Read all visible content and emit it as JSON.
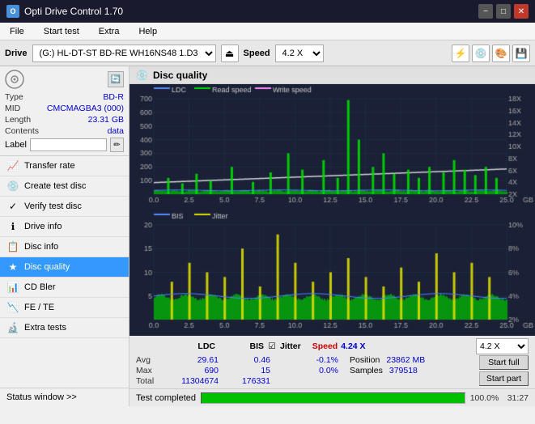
{
  "titleBar": {
    "title": "Opti Drive Control 1.70",
    "iconText": "O",
    "minBtn": "−",
    "maxBtn": "□",
    "closeBtn": "✕"
  },
  "menuBar": {
    "items": [
      "File",
      "Start test",
      "Extra",
      "Help"
    ]
  },
  "driveBar": {
    "label": "Drive",
    "driveValue": "(G:)  HL-DT-ST BD-RE  WH16NS48 1.D3",
    "ejectIcon": "⏏",
    "speedLabel": "Speed",
    "speedValue": "4.2 X",
    "actionBtns": [
      "⚡",
      "💿",
      "🔧",
      "💾"
    ]
  },
  "disc": {
    "typeLabel": "Type",
    "typeValue": "BD-R",
    "midLabel": "MID",
    "midValue": "CMCMAGBA3 (000)",
    "lengthLabel": "Length",
    "lengthValue": "23.31 GB",
    "contentsLabel": "Contents",
    "contentsValue": "data",
    "labelLabel": "Label"
  },
  "sidebar": {
    "navItems": [
      {
        "id": "transfer-rate",
        "label": "Transfer rate",
        "icon": "📈"
      },
      {
        "id": "create-test-disc",
        "label": "Create test disc",
        "icon": "💿"
      },
      {
        "id": "verify-test-disc",
        "label": "Verify test disc",
        "icon": "✓"
      },
      {
        "id": "drive-info",
        "label": "Drive info",
        "icon": "ℹ"
      },
      {
        "id": "disc-info",
        "label": "Disc info",
        "icon": "📋"
      },
      {
        "id": "disc-quality",
        "label": "Disc quality",
        "icon": "★",
        "active": true
      },
      {
        "id": "cd-bler",
        "label": "CD Bler",
        "icon": "📊"
      },
      {
        "id": "fe-te",
        "label": "FE / TE",
        "icon": "📉"
      },
      {
        "id": "extra-tests",
        "label": "Extra tests",
        "icon": "🔬"
      }
    ],
    "statusWindow": "Status window >>"
  },
  "discQuality": {
    "title": "Disc quality",
    "legends1": {
      "ldc": "LDC",
      "readSpeed": "Read speed",
      "writeSpeed": "Write speed"
    },
    "legends2": {
      "bis": "BIS",
      "jitter": "Jitter"
    },
    "yAxis1": [
      700,
      600,
      500,
      400,
      300,
      200,
      100
    ],
    "yAxis1Right": [
      "18X",
      "16X",
      "14X",
      "12X",
      "10X",
      "8X",
      "6X",
      "4X",
      "2X"
    ],
    "xAxis": [
      "0.0",
      "2.5",
      "5.0",
      "7.5",
      "10.0",
      "12.5",
      "15.0",
      "17.5",
      "20.0",
      "22.5",
      "25.0"
    ],
    "yAxis2": [
      20,
      15,
      10,
      5
    ],
    "yAxis2Right": [
      "10%",
      "8%",
      "6%",
      "4%",
      "2%"
    ]
  },
  "stats": {
    "headers": {
      "ldc": "LDC",
      "bis": "BIS",
      "jitter": "Jitter",
      "speed": "Speed",
      "speedVal": "4.24 X"
    },
    "avg": {
      "label": "Avg",
      "ldc": "29.61",
      "bis": "0.46",
      "jitter": "-0.1%"
    },
    "max": {
      "label": "Max",
      "ldc": "690",
      "bis": "15",
      "jitter": "0.0%",
      "position": "23862 MB"
    },
    "total": {
      "label": "Total",
      "ldc": "11304674",
      "bis": "176331",
      "samples": "379518"
    },
    "positionLabel": "Position",
    "samplesLabel": "Samples",
    "speedSelectVal": "4.2 X",
    "startFull": "Start full",
    "startPart": "Start part"
  },
  "progressBar": {
    "percent": 100,
    "percentText": "100.0%",
    "statusText": "Test completed",
    "time": "31:27"
  },
  "colors": {
    "ldcColor": "#5588ff",
    "readColor": "#00ee00",
    "writeColor": "#ff88ff",
    "bisColor": "#5588ff",
    "jitterColor": "#eeee00",
    "bgChart": "#1a2035",
    "gridColor": "#2a3050",
    "activeNav": "#3399ff"
  }
}
